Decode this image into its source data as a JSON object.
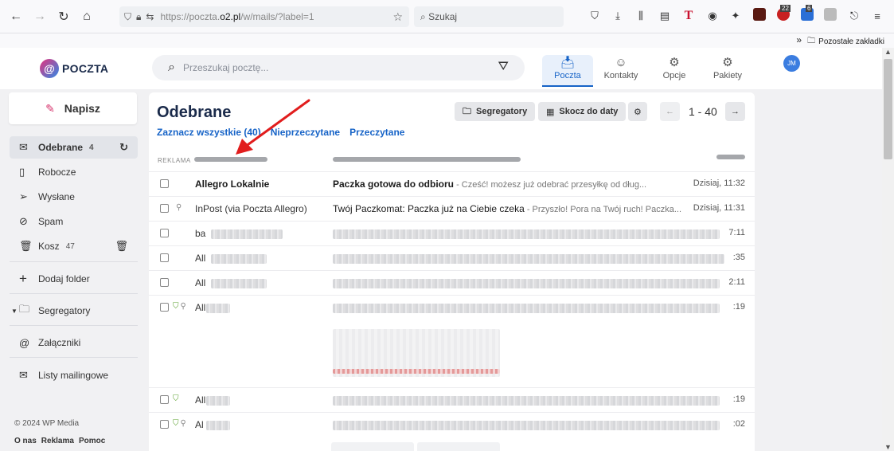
{
  "browser": {
    "url_prefix": "https://poczta.",
    "url_domain": "o2.pl",
    "url_path": "/w/mails/?label=1",
    "search_placeholder": "Szukaj",
    "badge_22": "22",
    "badge_6": "6",
    "bookmarks_folder": "Pozostałe zakładki"
  },
  "app": {
    "logo_text": "POCZTA",
    "search_placeholder": "Przeszukaj pocztę...",
    "tabs": [
      {
        "label": "Poczta",
        "icon": "inbox-icon"
      },
      {
        "label": "Kontakty",
        "icon": "contacts-icon"
      },
      {
        "label": "Opcje",
        "icon": "gear-icon"
      },
      {
        "label": "Pakiety",
        "icon": "packages-icon"
      }
    ],
    "avatar_initials": "JM"
  },
  "sidebar": {
    "compose_label": "Napisz",
    "items": [
      {
        "label": "Odebrane",
        "count": "4"
      },
      {
        "label": "Robocze",
        "count": ""
      },
      {
        "label": "Wysłane",
        "count": ""
      },
      {
        "label": "Spam",
        "count": ""
      },
      {
        "label": "Kosz",
        "count": "47"
      }
    ],
    "add_folder": "Dodaj folder",
    "binders": "Segregatory",
    "attachments": "Załączniki",
    "mailing_lists": "Listy mailingowe",
    "copyright": "© 2024 WP Media",
    "footer_links": [
      "O nas",
      "Reklama",
      "Pomoc"
    ]
  },
  "main": {
    "title": "Odebrane",
    "filters": [
      "Zaznacz wszystkie (40)",
      "Nieprzeczytane",
      "Przeczytane"
    ],
    "toolbar": {
      "binders": "Segregatory",
      "jump_to_date": "Skocz do daty"
    },
    "pager": "1 - 40",
    "ad_label": "REKLAMA",
    "messages": [
      {
        "sender": "Allegro Lokalnie",
        "subject": "Paczka gotowa do odbioru",
        "preview": " - Cześć! możesz już odebrać przesyłkę od dług...",
        "date": "Dzisiaj, 11:32"
      },
      {
        "sender": "InPost (via Poczta Allegro)",
        "subject": "Twój Paczkomat: Paczka już na Ciebie czeka",
        "preview": " - Przyszło! Pora na Twój ruch! Paczka...",
        "date": "Dzisiaj, 11:31"
      },
      {
        "sender": "ba",
        "date": "7:11"
      },
      {
        "sender": "All",
        "date": ":35"
      },
      {
        "sender": "All",
        "date": "2:11"
      },
      {
        "sender": "All",
        "date": ":19"
      },
      {
        "sender": "All",
        "date": ":19"
      },
      {
        "sender": "Al",
        "date": ":02"
      }
    ]
  }
}
